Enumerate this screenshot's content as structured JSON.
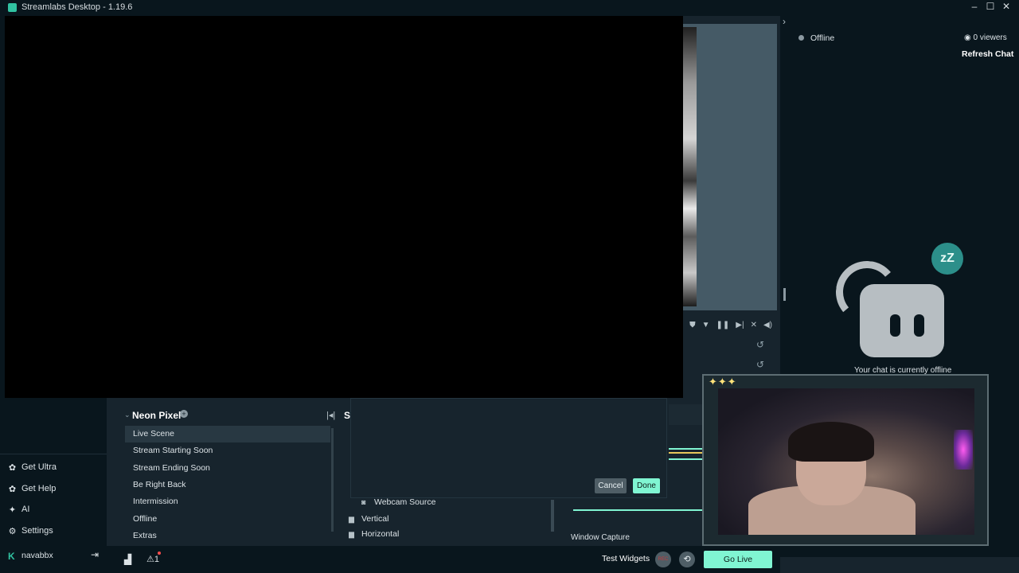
{
  "window": {
    "title": "Streamlabs Desktop - 1.19.6",
    "controls": [
      "–",
      "☐",
      "✕"
    ]
  },
  "nav": {
    "items": [
      {
        "label": "Get Ultra",
        "icon": "ultra-icon",
        "glyph": "✿"
      },
      {
        "label": "Get Help",
        "icon": "help-icon",
        "glyph": "✿"
      },
      {
        "label": "AI",
        "icon": "ai-icon",
        "glyph": "✦"
      },
      {
        "label": "Settings",
        "icon": "gear-icon",
        "glyph": "⚙"
      }
    ],
    "user": {
      "name": "navabbx",
      "logout_glyph": "⇥"
    }
  },
  "scenes": {
    "collection": "Neon Pixel",
    "items": [
      "Live Scene",
      "Stream Starting Soon",
      "Stream Ending Soon",
      "Be Right Back",
      "Intermission",
      "Offline",
      "Extras"
    ],
    "active_index": 0
  },
  "sources": {
    "title": "Sc",
    "items": [
      {
        "label": "Webcam Source",
        "icon": "camera-icon",
        "glyph": "◙"
      },
      {
        "label": "Vertical",
        "icon": "folder-icon",
        "glyph": "▆"
      },
      {
        "label": "Horizontal",
        "icon": "folder-icon",
        "glyph": "▆"
      }
    ]
  },
  "dialog": {
    "cancel_label": "Cancel",
    "done_label": "Done"
  },
  "mixer": {
    "label": "Window Capture"
  },
  "chat": {
    "status": "Offline",
    "viewers": "0 viewers",
    "refresh_label": "Refresh Chat",
    "offline_message": "Your chat is currently offline",
    "sleep_badge": "zZ"
  },
  "bottom": {
    "test_widgets_label": "Test Widgets",
    "rec_label": "REC",
    "go_live_label": "Go Live",
    "alert_count": "1"
  },
  "colors": {
    "accent": "#80f5d2",
    "panel": "#17242d",
    "nav": "#09161d"
  }
}
